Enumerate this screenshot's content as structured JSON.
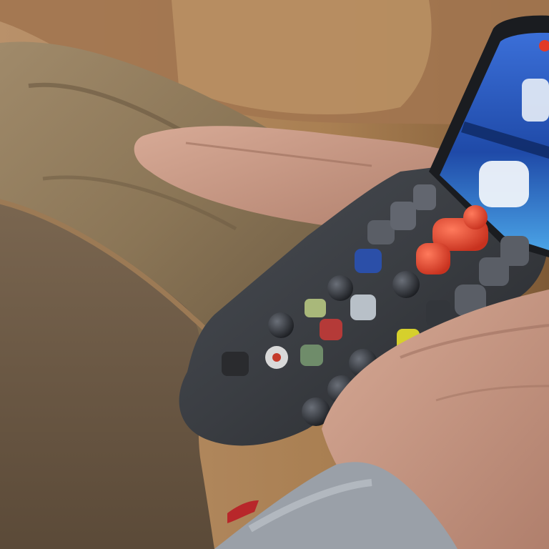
{
  "image": {
    "subject": "photo",
    "content_notes": "",
    "palette": {
      "couch_tan": "#b08a5e",
      "couch_dark": "#7a5d3f",
      "pants_khaki": "#8a7556",
      "pillow_brown": "#6e5a45",
      "remote_body": "#3a3d42",
      "remote_button_red": "#e0452e",
      "screen_blue": "#2f64c9",
      "skin": "#c79a86",
      "sleeve_gray": "#9aa0a8"
    }
  }
}
